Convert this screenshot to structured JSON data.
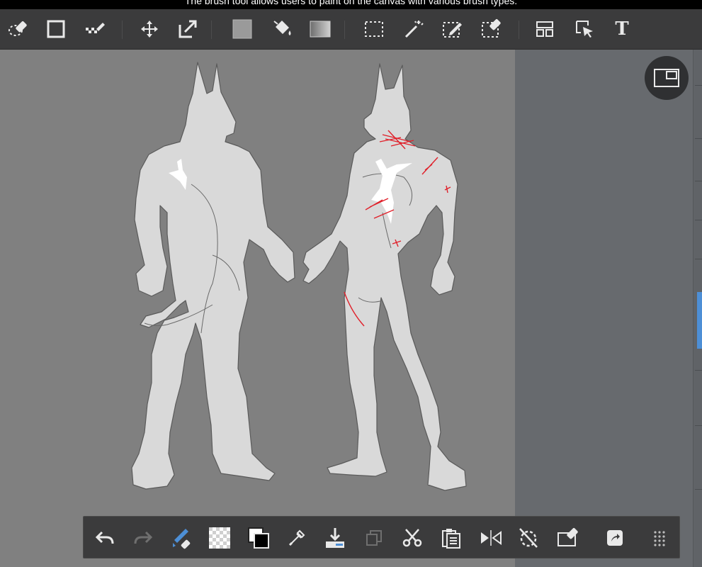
{
  "tooltip": {
    "text": "The brush tool allows users to paint on the canvas with various brush types."
  },
  "top_toolbar": {
    "items": [
      {
        "name": "lasso-eraser-icon"
      },
      {
        "name": "square-icon"
      },
      {
        "name": "dot-brush-icon"
      },
      {
        "name": "move-icon"
      },
      {
        "name": "transform-icon"
      },
      {
        "name": "fill-color-icon"
      },
      {
        "name": "paint-bucket-icon"
      },
      {
        "name": "gradient-icon"
      },
      {
        "name": "marquee-select-icon"
      },
      {
        "name": "magic-wand-icon"
      },
      {
        "name": "select-pen-icon"
      },
      {
        "name": "select-eraser-icon"
      },
      {
        "name": "panel-layout-icon"
      },
      {
        "name": "pointer-select-icon"
      },
      {
        "name": "text-tool-icon"
      }
    ],
    "text_tool_glyph": "T"
  },
  "navigator": {
    "icon": "navigator-window-icon"
  },
  "bottom_toolbar": {
    "items": [
      {
        "name": "undo-icon"
      },
      {
        "name": "redo-icon"
      },
      {
        "name": "brush-eraser-toggle-icon"
      },
      {
        "name": "transparent-color-icon"
      },
      {
        "name": "swap-colors-icon"
      },
      {
        "name": "eyedropper-icon"
      },
      {
        "name": "import-icon"
      },
      {
        "name": "duplicate-icon"
      },
      {
        "name": "cut-icon"
      },
      {
        "name": "paste-icon"
      },
      {
        "name": "flip-horizontal-icon"
      },
      {
        "name": "rotate-reset-icon"
      },
      {
        "name": "clear-layer-icon"
      },
      {
        "name": "share-icon"
      },
      {
        "name": "more-menu-icon"
      }
    ]
  },
  "colors": {
    "toolbar_bg": "#3b3b3c",
    "canvas_bg": "#808080",
    "side_bg": "#676a6e",
    "icon": "#e9e9e9",
    "accent": "#4d8fd6",
    "figure_fill": "#d9d9d9",
    "highlight": "#ffffff",
    "scar_red": "#e0202a"
  }
}
